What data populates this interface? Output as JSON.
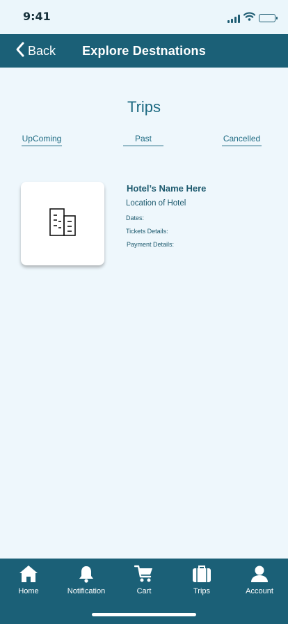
{
  "status_bar": {
    "time": "9:41",
    "icons": [
      "signal-icon",
      "wifi-icon",
      "battery-icon"
    ]
  },
  "nav_bar": {
    "back_label": "Back",
    "title": "Explore Destnations",
    "back_icon": "chevron-left-icon"
  },
  "page": {
    "title": "Trips"
  },
  "tabs": [
    {
      "label": "UpComing"
    },
    {
      "label": "Past"
    },
    {
      "label": "Cancelled"
    }
  ],
  "trip": {
    "image_icon": "building-icon",
    "hotel_name": "Hotel’s  Name Here",
    "location": "Location of Hotel",
    "dates_label": "Dates:",
    "tickets_label": "Tickets Details:",
    "payment_label": "Payment Details:"
  },
  "tab_bar": {
    "items": [
      {
        "label": "Home",
        "icon": "home-icon"
      },
      {
        "label": "Notification",
        "icon": "bell-icon"
      },
      {
        "label": "Cart",
        "icon": "cart-icon"
      },
      {
        "label": "Trips",
        "icon": "suitcase-icon"
      },
      {
        "label": "Account",
        "icon": "user-icon"
      }
    ]
  },
  "colors": {
    "primary": "#1b6077",
    "background": "#eef7fc",
    "text": "#1d5a6e",
    "card": "#ffffff"
  }
}
